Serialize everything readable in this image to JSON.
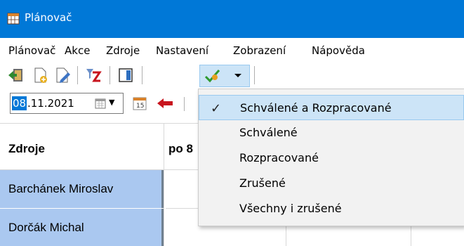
{
  "window": {
    "title": "Plánovač",
    "icon": "calendar-app-icon"
  },
  "menu": {
    "items": [
      {
        "label": "Plánovač"
      },
      {
        "label": "Akce"
      },
      {
        "label": "Zdroje"
      },
      {
        "label": "Nastavení"
      },
      {
        "label": "Zobrazení"
      },
      {
        "label": "Nápověda"
      }
    ]
  },
  "toolbar": {
    "icons": [
      "exit-icon",
      "new-document-icon",
      "edit-document-icon",
      "filter-z-icon",
      "layout-panel-icon",
      "approve-filter-icon",
      "dropdown-arrow-icon"
    ]
  },
  "date_toolbar": {
    "date_day": "08",
    "date_rest": ".11.2021",
    "icons": [
      "calendar-picker-icon",
      "today-calendar-icon",
      "previous-arrow-icon"
    ]
  },
  "grid": {
    "resource_header": "Zdroje",
    "day_header": "po 8",
    "resources": [
      "Barchánek Miroslav",
      "Dorčák Michal"
    ]
  },
  "dropdown": {
    "items": [
      {
        "label": "Schválené a Rozpracované",
        "checked": true
      },
      {
        "label": "Schválené",
        "checked": false
      },
      {
        "label": "Rozpracované",
        "checked": false
      },
      {
        "label": "Zrušené",
        "checked": false
      },
      {
        "label": "Všechny i zrušené",
        "checked": false
      }
    ],
    "check_glyph": "✓"
  },
  "colors": {
    "titlebar": "#0078d7",
    "resource_cell": "#aac8f0",
    "selected_item": "#cce4f7",
    "menu_bg": "#f2f2f2"
  }
}
